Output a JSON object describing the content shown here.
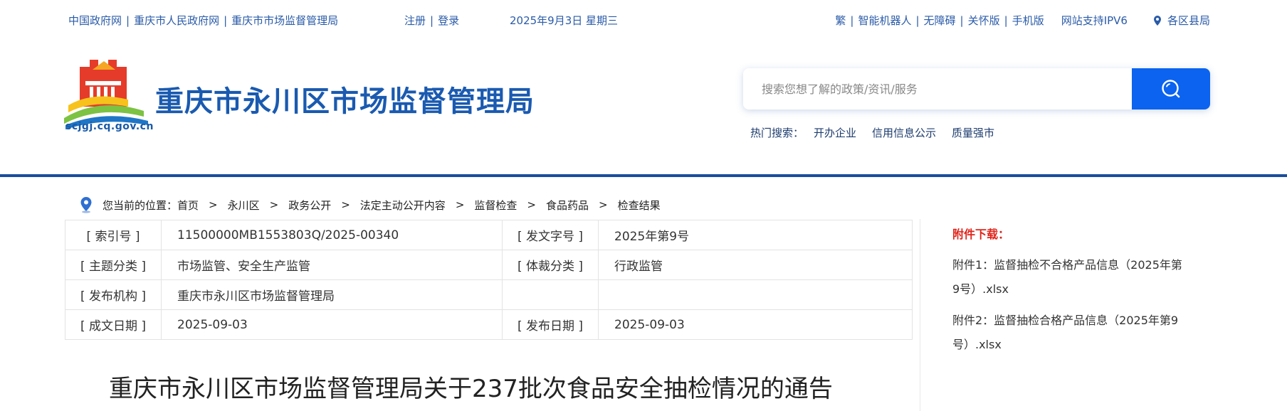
{
  "topbar": {
    "links_left": [
      "中国政府网",
      "重庆市人民政府网",
      "重庆市市场监督管理局"
    ],
    "register": "注册",
    "login": "登录",
    "date": "2025年9月3日 星期三",
    "links_right": [
      "繁",
      "智能机器人",
      "无障碍",
      "关怀版",
      "手机版"
    ],
    "ipv6": "网站支持IPV6",
    "region": "各区县局",
    "separator": "|"
  },
  "header": {
    "logo_url": "scjgj.cq.gov.cn",
    "title": "重庆市永川区市场监督管理局",
    "search": {
      "placeholder": "搜索您想了解的政策/资讯/服务"
    },
    "hot_label": "热门搜索：",
    "hot_items": [
      "开办企业",
      "信用信息公示",
      "质量强市"
    ]
  },
  "breadcrumb": {
    "prefix": "您当前的位置：",
    "items": [
      "首页",
      "永川区",
      "政务公开",
      "法定主动公开内容",
      "监督检查",
      "食品药品",
      "检查结果"
    ],
    "separator": ">"
  },
  "info": {
    "rows": [
      {
        "k1": "[ 索引号 ]",
        "v1": "11500000MB1553803Q/2025-00340",
        "k2": "[ 发文字号 ]",
        "v2": "2025年第9号"
      },
      {
        "k1": "[ 主题分类 ]",
        "v1": "市场监管、安全生产监管",
        "k2": "[ 体裁分类 ]",
        "v2": "行政监管"
      },
      {
        "k1": "[ 发布机构 ]",
        "v1": "重庆市永川区市场监督管理局",
        "k2": "",
        "v2": ""
      },
      {
        "k1": "[ 成文日期 ]",
        "v1": "2025-09-03",
        "k2": "[ 发布日期 ]",
        "v2": "2025-09-03"
      }
    ]
  },
  "article": {
    "title": "重庆市永川区市场监督管理局关于237批次食品安全抽检情况的通告"
  },
  "attachments": {
    "title": "附件下载：",
    "items": [
      "附件1：监督抽检不合格产品信息（2025年第9号）.xlsx",
      "附件2：监督抽检合格产品信息（2025年第9号）.xlsx"
    ]
  },
  "colors": {
    "brand_blue": "#1a5ab0",
    "search_button": "#0b63f0",
    "header_line": "#1a4d9c",
    "attachment_title": "#e0241a"
  },
  "icons": {
    "region": "location-pin-icon",
    "search": "search-icon",
    "breadcrumb": "location-pin-icon"
  }
}
